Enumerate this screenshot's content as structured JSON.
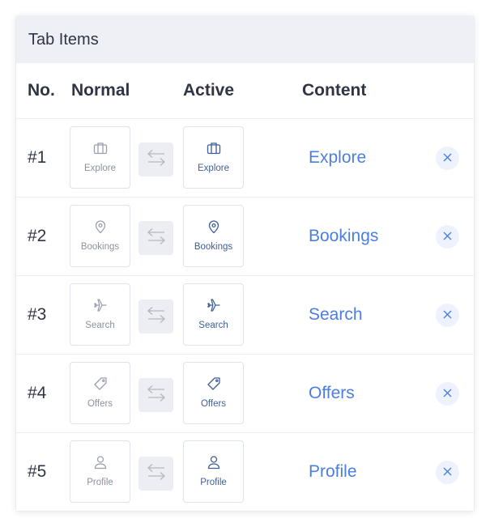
{
  "panel": {
    "title": "Tab Items"
  },
  "columns": {
    "no": "No.",
    "normal": "Normal",
    "active": "Active",
    "content": "Content"
  },
  "colors": {
    "accent": "#4a7fe0",
    "normal_icon": "#9aa0ab",
    "active_icon": "#3e5f95",
    "header_bg": "#eef0f6"
  },
  "rows": [
    {
      "no": "#1",
      "icon": "briefcase-icon",
      "label": "Explore",
      "content": "Explore"
    },
    {
      "no": "#2",
      "icon": "map-pin-icon",
      "label": "Bookings",
      "content": "Bookings"
    },
    {
      "no": "#3",
      "icon": "plane-icon",
      "label": "Search",
      "content": "Search"
    },
    {
      "no": "#4",
      "icon": "tag-icon",
      "label": "Offers",
      "content": "Offers"
    },
    {
      "no": "#5",
      "icon": "user-icon",
      "label": "Profile",
      "content": "Profile"
    }
  ]
}
